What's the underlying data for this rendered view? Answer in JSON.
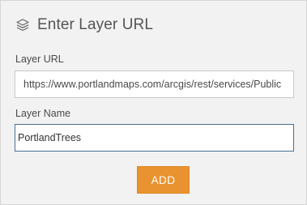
{
  "header": {
    "title": "Enter Layer URL",
    "icon": "layers-icon"
  },
  "layer_url": {
    "label": "Layer URL",
    "value": "https://www.portlandmaps.com/arcgis/rest/services/Public"
  },
  "layer_name": {
    "label": "Layer Name",
    "value": "PortlandTrees"
  },
  "add_button": {
    "label": "ADD"
  },
  "colors": {
    "panel_bg": "#f2f2f2",
    "button_bg": "#e8932f",
    "focus_border": "#4a6f95",
    "text": "#555555"
  }
}
